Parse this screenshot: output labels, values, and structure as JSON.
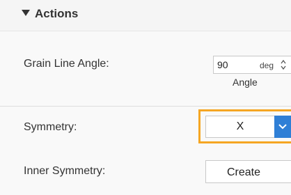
{
  "section": {
    "title": "Actions",
    "expanded": true
  },
  "grain_line_angle": {
    "label": "Grain Line Angle:",
    "value": "90",
    "unit": "deg",
    "caption": "Angle"
  },
  "symmetry": {
    "label": "Symmetry:",
    "selected": "X"
  },
  "inner_symmetry": {
    "label": "Inner Symmetry:",
    "button_label": "Create"
  },
  "colors": {
    "highlight": "#f5a623",
    "dropdown_accent": "#2f7fd6"
  }
}
